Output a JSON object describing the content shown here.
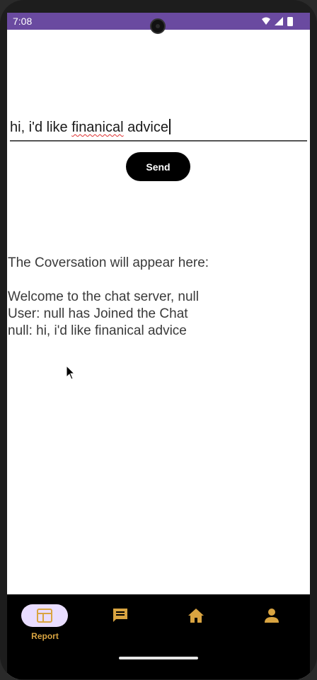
{
  "status_bar": {
    "time": "7:08",
    "icons": [
      "wifi-icon",
      "signal-icon",
      "battery-icon"
    ],
    "color": "#6a4aa0"
  },
  "chat": {
    "input_value_before": "hi, i'd like ",
    "input_misspelled": "finanical",
    "input_value_after": " advice",
    "send_label": "Send"
  },
  "conversation": {
    "header": "The Coversation will appear here:",
    "lines": [
      "Welcome to the chat server, null",
      "User: null has Joined the Chat",
      "null: hi, i'd like finanical advice"
    ]
  },
  "bottom_nav": {
    "accent": "#d9a441",
    "pill_color": "#e9ddff",
    "items": [
      {
        "label": "Report",
        "icon": "report-icon",
        "selected": true
      },
      {
        "label": "",
        "icon": "chat-icon",
        "selected": false
      },
      {
        "label": "",
        "icon": "home-icon",
        "selected": false
      },
      {
        "label": "",
        "icon": "profile-icon",
        "selected": false
      }
    ]
  }
}
